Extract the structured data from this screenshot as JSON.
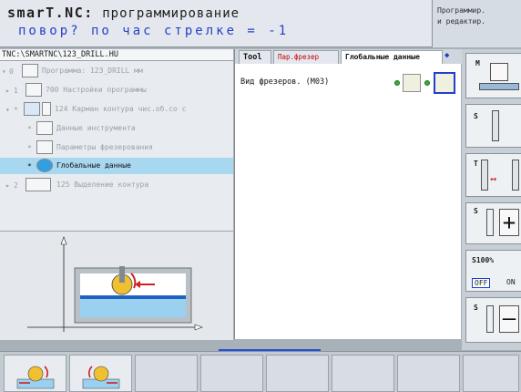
{
  "header": {
    "brand": "smarT.NC:",
    "title": "программирование",
    "subtitle": "повор? по час стрелке = -1",
    "mode_line1": "Программир.",
    "mode_line2": "и редактир."
  },
  "path": "TNC:\\SMARTNC\\123_DRILL.HU",
  "tree": {
    "rows": [
      {
        "index": "0",
        "text": "Программа: 123_DRILL мм"
      },
      {
        "index": "1",
        "text": "700 Настройки программы"
      },
      {
        "index": "*",
        "text": "124 Карман контура чис.об.со с"
      },
      {
        "index": "*",
        "text": "Данные инструмента"
      },
      {
        "index": "*",
        "text": "Параметры фрезерования"
      },
      {
        "index": "*",
        "text": "Глобальные данные"
      },
      {
        "index": "2",
        "text": "125 Выделение контура"
      }
    ]
  },
  "form": {
    "tabs": [
      "Tool",
      "Пар.фрезер",
      "Глобальные данные"
    ],
    "field_label": "Вид фрезеров. (M03)"
  },
  "softkeys": {
    "m": "M",
    "s": "S",
    "t": "T",
    "s_plus": "S",
    "s100": "S100%",
    "off": "OFF",
    "on": "ON",
    "s_minus": "S"
  },
  "colors": {
    "accent_blue": "#2040c8",
    "selection": "#a8d8f0",
    "tab_red": "#c00000"
  }
}
